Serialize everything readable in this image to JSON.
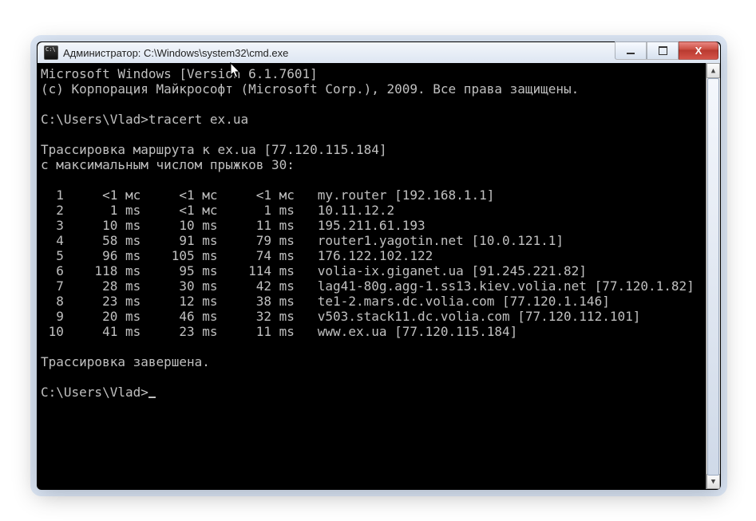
{
  "window": {
    "title": "Администратор: C:\\Windows\\system32\\cmd.exe"
  },
  "terminal": {
    "banner_line1": "Microsoft Windows [Version 6.1.7601]",
    "banner_line2": "(c) Корпорация Майкрософт (Microsoft Corp.), 2009. Все права защищены.",
    "prompt1": "C:\\Users\\Vlad>",
    "command1": "tracert ex.ua",
    "trace_header1": "Трассировка маршрута к ex.ua [77.120.115.184]",
    "trace_header2": "с максимальным числом прыжков 30:",
    "hops": [
      {
        "n": "1",
        "t1": "<1 мс",
        "t2": "<1 мс",
        "t3": "<1 мс",
        "host": "my.router [192.168.1.1]"
      },
      {
        "n": "2",
        "t1": "1 ms",
        "t2": "<1 мс",
        "t3": "1 ms",
        "host": "10.11.12.2"
      },
      {
        "n": "3",
        "t1": "10 ms",
        "t2": "10 ms",
        "t3": "11 ms",
        "host": "195.211.61.193"
      },
      {
        "n": "4",
        "t1": "58 ms",
        "t2": "91 ms",
        "t3": "79 ms",
        "host": "router1.yagotin.net [10.0.121.1]"
      },
      {
        "n": "5",
        "t1": "96 ms",
        "t2": "105 ms",
        "t3": "74 ms",
        "host": "176.122.102.122"
      },
      {
        "n": "6",
        "t1": "118 ms",
        "t2": "95 ms",
        "t3": "114 ms",
        "host": "volia-ix.giganet.ua [91.245.221.82]"
      },
      {
        "n": "7",
        "t1": "28 ms",
        "t2": "30 ms",
        "t3": "42 ms",
        "host": "lag41-80g.agg-1.ss13.kiev.volia.net [77.120.1.82]"
      },
      {
        "n": "8",
        "t1": "23 ms",
        "t2": "12 ms",
        "t3": "38 ms",
        "host": "te1-2.mars.dc.volia.com [77.120.1.146]"
      },
      {
        "n": "9",
        "t1": "20 ms",
        "t2": "46 ms",
        "t3": "32 ms",
        "host": "v503.stack11.dc.volia.com [77.120.112.101]"
      },
      {
        "n": "10",
        "t1": "41 ms",
        "t2": "23 ms",
        "t3": "11 ms",
        "host": "www.ex.ua [77.120.115.184]"
      }
    ],
    "trace_done": "Трассировка завершена.",
    "prompt2": "C:\\Users\\Vlad>"
  }
}
